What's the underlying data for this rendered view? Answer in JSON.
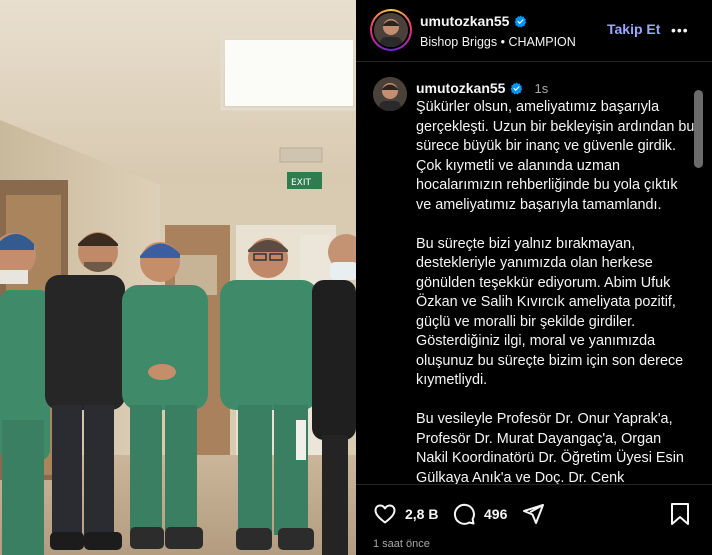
{
  "post": {
    "username": "umutozkan55",
    "subtitle": "Bishop Briggs • CHAMPION",
    "follow_label": "Takip Et",
    "more_label": "•••",
    "caption_time": "1s",
    "caption_paragraphs": [
      "Şükürler olsun, ameliyatımız başarıyla gerçekleşti. Uzun bir bekleyişin ardından bu sürece büyük bir inanç ve güvenle girdik. Çok kıymetli ve alanında uzman hocalarımızın rehberliğinde bu yola çıktık ve ameliyatımız başarıyla tamamlandı.",
      "Bu süreçte bizi yalnız bırakmayan, destekleriyle yanımızda olan herkese gönülden teşekkür ediyorum. Abim Ufuk Özkan ve Salih Kıvırcık ameliyata pozitif, güçlü ve moralli bir şekilde girdiler. Gösterdiğiniz ilgi, moral ve yanımızda oluşunuz bu süreçte bizim için son derece kıymetliydi.",
      "Bu vesileyle Profesör Dr. Onur Yaprak'a, Profesör Dr. Murat Dayangaç'a, Organ Nakil Koordinatörü Dr. Öğretim Üyesi Esin Gülkaya Anık'a ve Doç. Dr. Cenk"
    ],
    "likes": "2,8 B",
    "comments": "496",
    "time_ago": "1 saat önce"
  },
  "photo": {
    "exit_sign": "EXIT"
  },
  "colors": {
    "follow": "#9aa8ff",
    "verified": "#0095f6",
    "scrubs": "#3f8a68"
  },
  "icons": [
    "verified-badge-icon",
    "heart-icon",
    "comment-icon",
    "share-icon",
    "bookmark-icon",
    "more-icon"
  ]
}
